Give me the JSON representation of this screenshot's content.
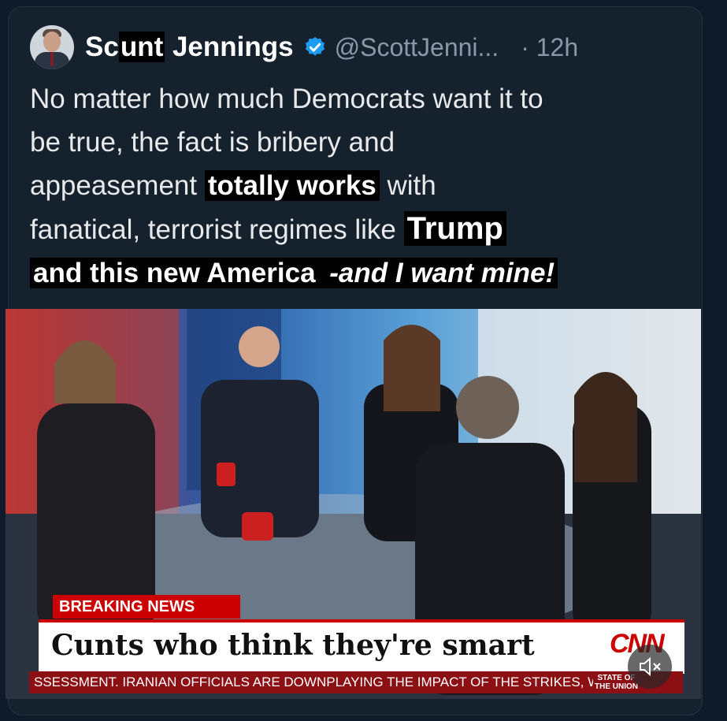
{
  "tweet": {
    "name_part1": "Sc",
    "name_highlight": "unt",
    "name_part2": " Jennings",
    "handle": "@ScottJenni...",
    "time": "12h",
    "line1": "No matter how much Democrats want it to",
    "line2": "be true, the fact is bribery and",
    "line3_a": "appeasement ",
    "line3_b": "totally works",
    "line3_c": " with",
    "line4_a": "fanatical, terrorist regimes like ",
    "line4_b": "Trump",
    "line5_a": "and this new America ",
    "line5_b": "-and I want mine!"
  },
  "media": {
    "breaking_label": "BREAKING NEWS",
    "headline": "Cunts who think they're smart",
    "network_logo": "CNN",
    "ticker": "SSESSMENT. IRANIAN OFFICIALS ARE DOWNPLAYING THE IMPACT OF THE STRIKES, WITH",
    "show_line1": "STATE OF",
    "show_line2": "THE UNION",
    "mute_icon": "speaker-muted-icon"
  },
  "colors": {
    "background": "#16212e",
    "verified": "#1d9bf0",
    "cnn_red": "#cc0000"
  }
}
